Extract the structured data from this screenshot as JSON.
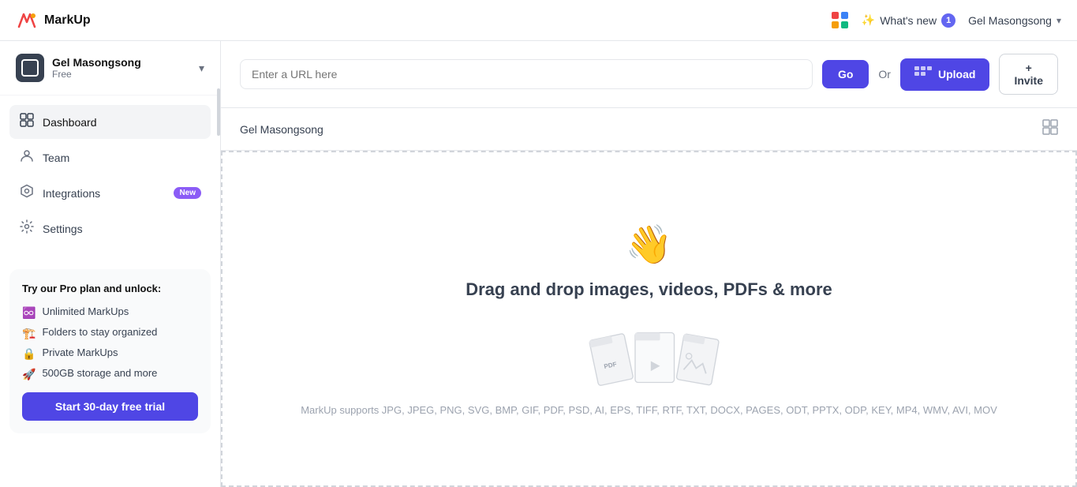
{
  "app": {
    "name": "MarkUp"
  },
  "topnav": {
    "whats_new_label": "What's new",
    "whats_new_badge": "1",
    "user_name": "Gel Masongsong"
  },
  "sidebar": {
    "workspace": {
      "name": "Gel Masongsong",
      "plan": "Free"
    },
    "nav_items": [
      {
        "id": "dashboard",
        "label": "Dashboard",
        "active": true
      },
      {
        "id": "team",
        "label": "Team",
        "active": false
      },
      {
        "id": "integrations",
        "label": "Integrations",
        "active": false,
        "badge": "New"
      },
      {
        "id": "settings",
        "label": "Settings",
        "active": false
      }
    ],
    "pro_box": {
      "title": "Try our Pro plan and unlock:",
      "features": [
        {
          "icon": "♾️",
          "text": "Unlimited MarkUps"
        },
        {
          "icon": "🏗️",
          "text": "Folders to stay organized"
        },
        {
          "icon": "🔒",
          "text": "Private MarkUps"
        },
        {
          "icon": "🚀",
          "text": "500GB storage and more"
        }
      ],
      "cta_label": "Start 30-day free trial"
    }
  },
  "main": {
    "url_input_placeholder": "Enter a URL here",
    "go_label": "Go",
    "or_label": "Or",
    "upload_label": "Upload",
    "invite_label": "+ Invite",
    "user_section": "Gel Masongsong",
    "drop_zone": {
      "emoji": "👋",
      "title": "Drag and drop images, videos, PDFs & more",
      "supported": "MarkUp supports JPG, JPEG, PNG, SVG, BMP, GIF, PDF, PSD, AI, EPS, TIFF, RTF, TXT, DOCX, PAGES, ODT, PPTX, ODP, KEY, MP4, WMV, AVI, MOV"
    }
  }
}
